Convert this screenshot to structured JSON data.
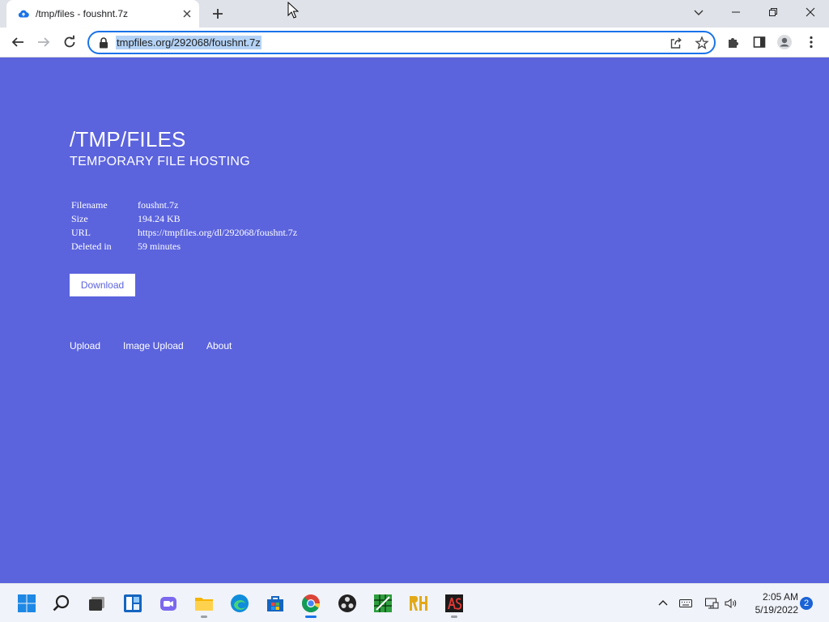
{
  "browser": {
    "tab_title": "/tmp/files - foushnt.7z",
    "url": "tmpfiles.org/292068/foushnt.7z"
  },
  "page": {
    "title": "/TMP/FILES",
    "subtitle": "TEMPORARY FILE HOSTING",
    "file_info": [
      {
        "key": "Filename",
        "value": "foushnt.7z"
      },
      {
        "key": "Size",
        "value": "194.24 KB"
      },
      {
        "key": "URL",
        "value": "https://tmpfiles.org/dl/292068/foushnt.7z"
      },
      {
        "key": "Deleted in",
        "value": "59 minutes"
      }
    ],
    "download_label": "Download",
    "nav": [
      "Upload",
      "Image Upload",
      "About"
    ]
  },
  "taskbar": {
    "time": "2:05 AM",
    "date": "5/19/2022",
    "notification_count": "2"
  },
  "colors": {
    "page_background": "#5b63dd",
    "accent": "#1a73e8"
  }
}
